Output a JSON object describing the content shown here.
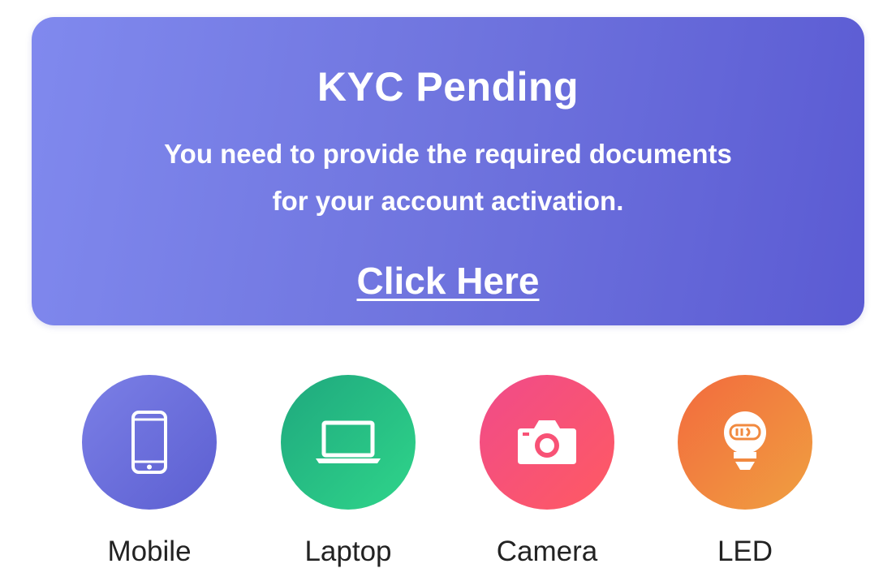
{
  "kyc": {
    "title": "KYC Pending",
    "message": "You need to provide the required documents for your account activation.",
    "link_label": "Click Here"
  },
  "categories": [
    {
      "label": "Mobile",
      "icon": "mobile-phone-icon",
      "color": "#6c6fdc"
    },
    {
      "label": "Laptop",
      "icon": "laptop-icon",
      "color": "#27c083"
    },
    {
      "label": "Camera",
      "icon": "camera-icon",
      "color": "#f85276"
    },
    {
      "label": "LED",
      "icon": "led-bulb-icon",
      "color": "#f18a40"
    }
  ]
}
